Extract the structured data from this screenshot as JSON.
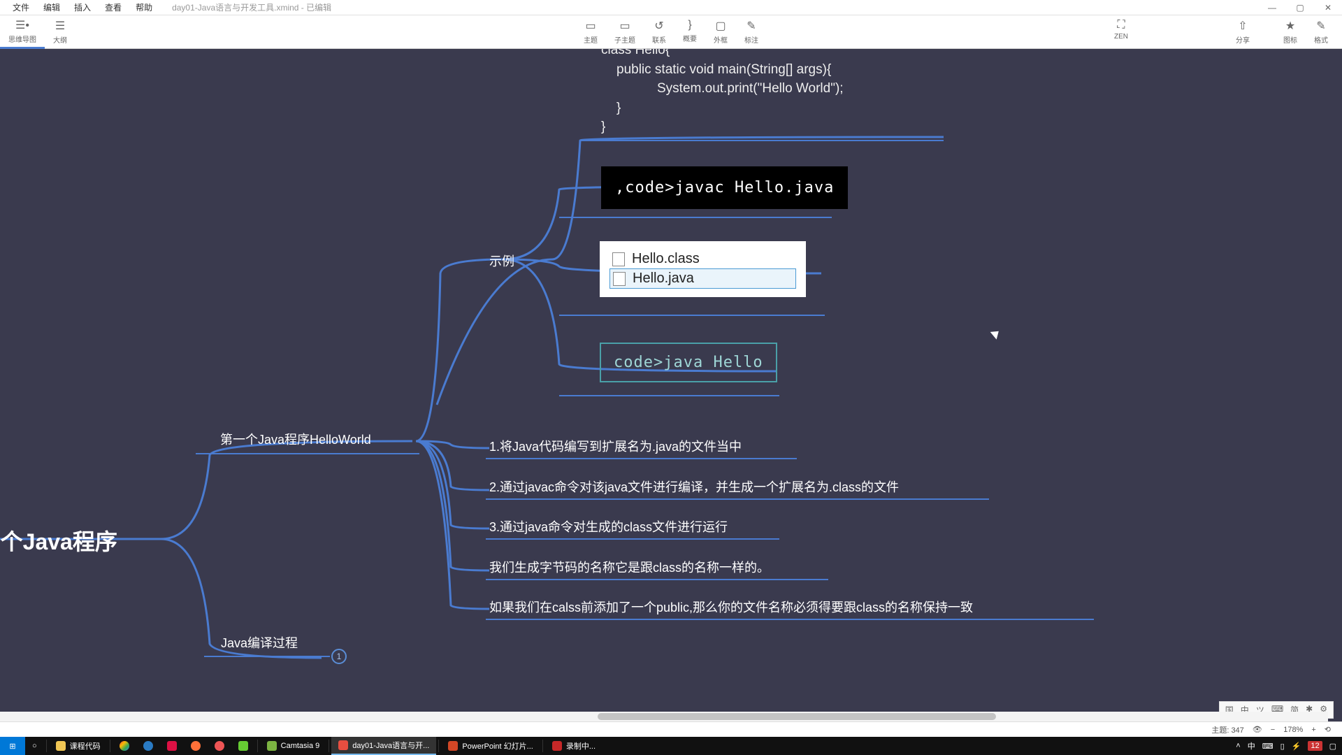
{
  "menu": {
    "file": "文件",
    "edit": "编辑",
    "insert": "插入",
    "view": "查看",
    "help": "帮助",
    "doc": "day01-Java语言与开发工具.xmind - 已编辑"
  },
  "toolbar": {
    "mindmap": "思维导图",
    "outline": "大纲",
    "zen": "ZEN",
    "share": "分享",
    "star": "图标",
    "style": "格式",
    "center": {
      "a": "主题",
      "b": "子主题",
      "c": "联系",
      "d": "概要",
      "e": "外框",
      "f": "标注"
    }
  },
  "canvas": {
    "code": {
      "l1": "class Hello{",
      "l2": "public static void main(String[] args){",
      "l3": "System.out.print(\"Hello World\");",
      "l4": "}",
      "l5": "}"
    },
    "example": "示例",
    "javac": ",code>javac Hello.java",
    "files": {
      "a": "Hello.class",
      "b": "Hello.java"
    },
    "java": "code>java Hello",
    "root": "·个Java程序",
    "first": "第一个Java程序HelloWorld",
    "steps": {
      "s1": "1.将Java代码编写到扩展名为.java的文件当中",
      "s2": "2.通过javac命令对该java文件进行编译，并生成一个扩展名为.class的文件",
      "s3": "3.通过java命令对生成的class文件进行运行",
      "s4": "我们生成字节码的名称它是跟class的名称一样的。",
      "s5": "如果我们在calss前添加了一个public,那么你的文件名称必须得要跟class的名称保持一致"
    },
    "compile": "Java编译过程",
    "one": "1"
  },
  "status": {
    "topic": "主题: 347",
    "zoom": "178%"
  },
  "ime": {
    "a": "国",
    "b": "中",
    "c": "ツ",
    "d": "⌨",
    "e": "简",
    "f": "✱",
    "g": "⚙"
  },
  "taskbar": {
    "folder": "课程代码",
    "camtasia": "Camtasia 9",
    "xmind": "day01-Java语言与开...",
    "ppt": "PowerPoint 幻灯片...",
    "rec": "录制中..."
  },
  "tray": {
    "count": "12"
  }
}
